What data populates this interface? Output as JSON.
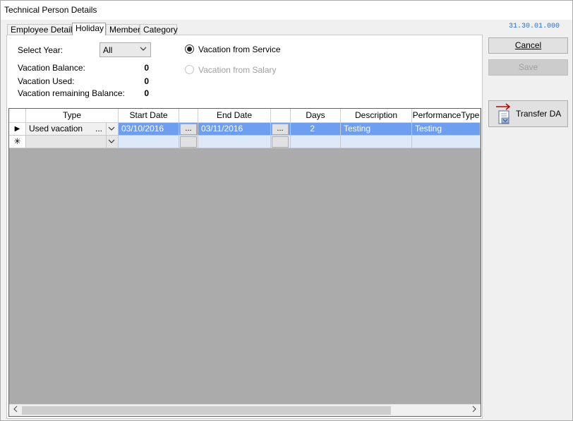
{
  "window": {
    "title": "Technical Person Details",
    "version": "31.30.01.000"
  },
  "tabs": [
    {
      "label": "Employee Details"
    },
    {
      "label": "Holiday"
    },
    {
      "label": "Member"
    },
    {
      "label": "Category"
    }
  ],
  "active_tab": "Holiday",
  "holiday": {
    "select_year_label": "Select Year:",
    "select_year_value": "All",
    "vacation_balance_label": "Vacation Balance:",
    "vacation_balance_value": "0",
    "vacation_used_label": "Vacation Used:",
    "vacation_used_value": "0",
    "vacation_remaining_label": "Vacation remaining Balance:",
    "vacation_remaining_value": "0",
    "radio_service_label": "Vacation from Service",
    "radio_salary_label": "Vacation from Salary",
    "radio_selected": "Vacation from Service"
  },
  "grid": {
    "columns": [
      "Type",
      "Start Date",
      "",
      "End Date",
      "",
      "Days",
      "Description",
      "PerformanceType"
    ],
    "rows": [
      {
        "type": "Used vacation",
        "type_ellipsis": "...",
        "start_date": "03/10/2016",
        "start_btn": "...",
        "end_date": "03/11/2016",
        "end_btn": "...",
        "days": "2",
        "description": "Testing",
        "performance_type": "Testing"
      }
    ],
    "current_row_marker": "▶",
    "new_row_marker": "✳"
  },
  "buttons": {
    "cancel": "Cancel",
    "save": "Save",
    "transfer": "Transfer DA"
  },
  "colors": {
    "selection": "#6e9ef0",
    "version_text": "#1e6fd9",
    "grid_background": "#ababab"
  }
}
